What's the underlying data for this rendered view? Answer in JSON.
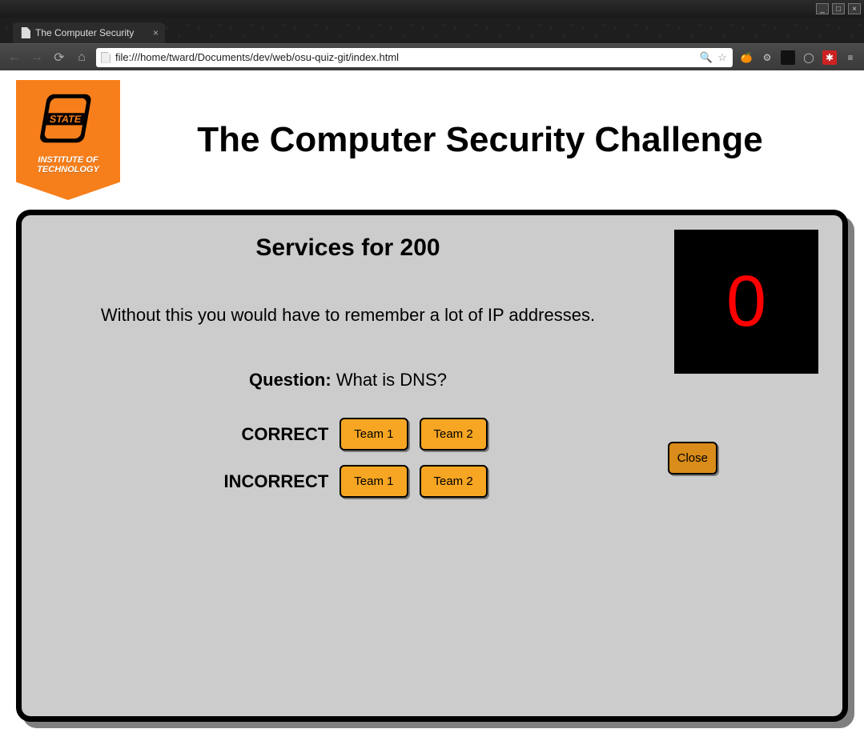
{
  "os": {
    "min_tip": "_",
    "max_tip": "□",
    "close_tip": "×"
  },
  "browser": {
    "tab_title": "The Computer Security",
    "tab_close": "×",
    "url": "file:///home/tward/Documents/dev/web/osu-quiz-git/index.html"
  },
  "header": {
    "banner_line1": "INSTITUTE OF",
    "banner_line2": "TECHNOLOGY",
    "logo_word": "STATE",
    "title": "The Computer Security Challenge"
  },
  "card": {
    "title": "Services for 200",
    "clue": "Without this you would have to remember a lot of IP addresses.",
    "question_label": "Question:",
    "question_answer": "What is DNS?",
    "row_correct": "CORRECT",
    "row_incorrect": "INCORRECT",
    "team1": "Team 1",
    "team2": "Team 2",
    "close": "Close",
    "timer": "0"
  }
}
